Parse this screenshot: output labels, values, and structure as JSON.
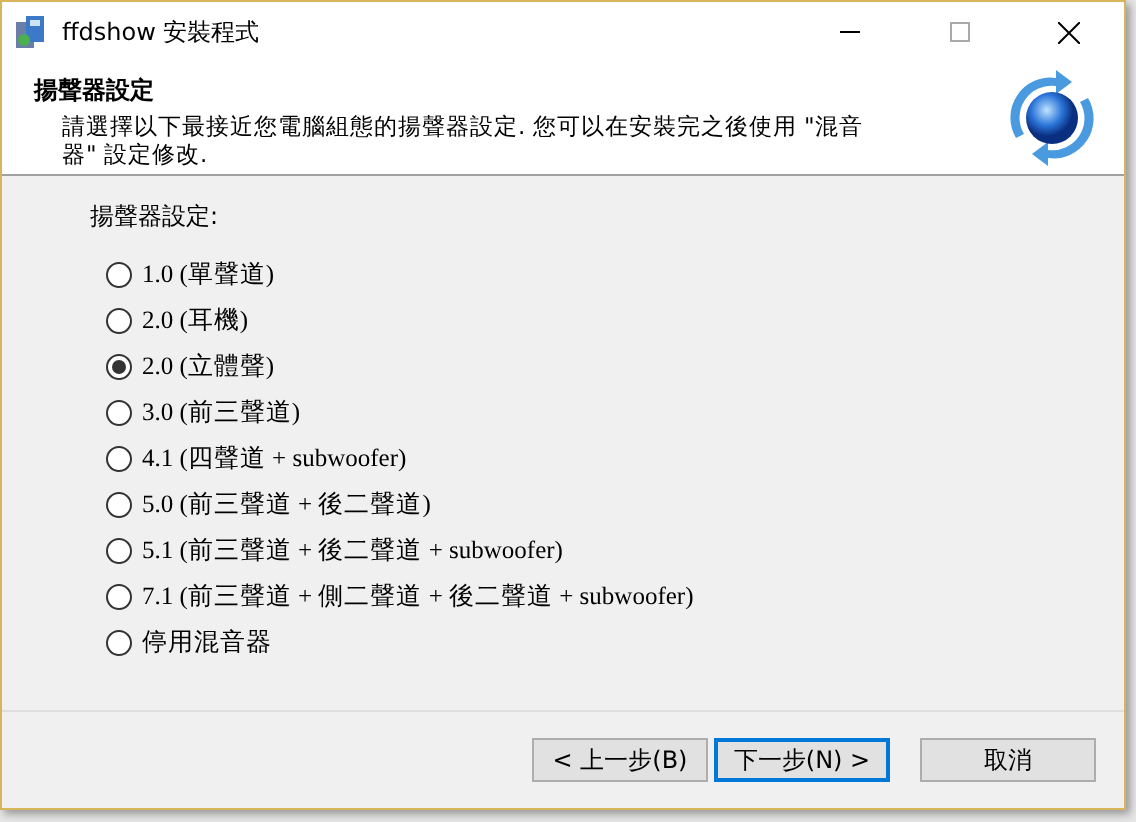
{
  "window": {
    "title": "ffdshow 安裝程式"
  },
  "header": {
    "title": "揚聲器設定",
    "description": "請選擇以下最接近您電腦組態的揚聲器設定. 您可以在安裝完之後使用 \"混音器\" 設定修改."
  },
  "group_label": "揚聲器設定:",
  "options": [
    {
      "label": "1.0 (單聲道)",
      "selected": false
    },
    {
      "label": "2.0 (耳機)",
      "selected": false
    },
    {
      "label": "2.0 (立體聲)",
      "selected": true
    },
    {
      "label": "3.0 (前三聲道)",
      "selected": false
    },
    {
      "label": "4.1 (四聲道 + subwoofer)",
      "selected": false
    },
    {
      "label": "5.0 (前三聲道 + 後二聲道)",
      "selected": false
    },
    {
      "label": "5.1 (前三聲道 + 後二聲道 + subwoofer)",
      "selected": false
    },
    {
      "label": "7.1 (前三聲道 + 側二聲道 + 後二聲道 + subwoofer)",
      "selected": false
    },
    {
      "label": "停用混音器",
      "selected": false
    }
  ],
  "buttons": [
    {
      "label": "< 上一步(B)",
      "default": false
    },
    {
      "label": "下一步(N) >",
      "default": true
    },
    {
      "label": "取消",
      "default": false
    }
  ]
}
